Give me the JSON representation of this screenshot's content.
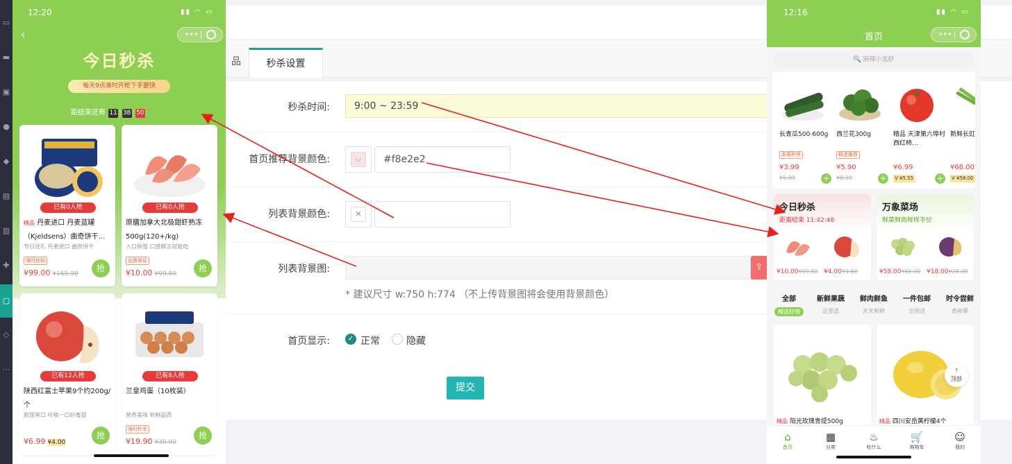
{
  "admin": {
    "tabs": {
      "prev_partial": "品",
      "seckill": "秒杀设置"
    },
    "form": {
      "time_label": "秒杀时间:",
      "time_value": "9:00 ~ 23:59",
      "home_bg_label": "首页推荐背景颜色:",
      "home_bg_value": "#f8e2e2",
      "home_bg_color": "#f8e2e2",
      "list_bg_label": "列表背景颜色:",
      "list_bg_value": "",
      "list_img_label": "列表背景图:",
      "size_hint": "* 建议尺寸 w:750 h:774 （不上传背景图将会使用背景颜色）",
      "home_show_label": "首页显示:",
      "opt_normal": "正常",
      "opt_hidden": "隐藏",
      "submit": "提交"
    }
  },
  "phone_left": {
    "time": "12:20",
    "title": "今日秒杀",
    "slogan": "每天9点准时开枪下手要快",
    "countdown_label": "距结束还有",
    "countdown": [
      "11",
      "38",
      "50"
    ],
    "products": [
      {
        "sold": "已有0人抢",
        "flag": "精品",
        "name": "丹麦进口 丹麦蓝罐（Kjeldsens）曲奇饼干…",
        "sub": "节日送礼 丹麦进口 曲奇饼干",
        "tag": "限时抢购",
        "price": "¥99.00",
        "old": "¥165.99",
        "grab": "抢"
      },
      {
        "sold": "已有0人抢",
        "flag": "",
        "name": "原膳加拿大北极甜虾熟冻 500g(120+/kg)",
        "sub": "入口鲜甜 口感解冻就能吃",
        "tag": "品质保证",
        "price": "¥10.00",
        "old": "¥99.80",
        "grab": "抢"
      },
      {
        "sold": "已有12人抢",
        "flag": "",
        "name": "陕西红富士苹果9个约200g/个",
        "sub": "脆甜爽口 咔嚓一口好香甜",
        "tag": "",
        "price": "¥6.99",
        "old": "¥4.00",
        "grab": "抢"
      },
      {
        "sold": "已有8人抢",
        "flag": "",
        "name": "兰皇鸡蛋（10枚装）",
        "sub": "营养美味 新鲜品质",
        "tag": "限时秒杀",
        "price": "¥19.90",
        "old": "¥39.90",
        "grab": "抢"
      }
    ]
  },
  "phone_right": {
    "time": "12:16",
    "title": "首页",
    "search_placeholder": "🔍 麻辣小龙虾",
    "strip": [
      {
        "name": "长青瓜500-600g",
        "tag": "本周秒杀",
        "price": "¥3.99",
        "old": "¥5.99"
      },
      {
        "name": "西兰花300g",
        "tag": "精选推荐",
        "price": "¥5.90",
        "old": "¥8.99"
      },
      {
        "name": "精品 天津第六埠村西红柿…",
        "tag": "",
        "price": "¥6.99",
        "vip": "V ¥5.55"
      },
      {
        "name": "新鲜长豇豆角",
        "tag": "",
        "price": "¥68.00",
        "vip": "V ¥58.00"
      }
    ],
    "promo_seckill": {
      "title": "今日秒杀",
      "sub": "距离结束 11:42:48",
      "p1": "¥10.00",
      "o1": "¥99.80",
      "p2": "¥4.00",
      "o2": "¥9.00"
    },
    "promo_market": {
      "title": "万象菜场",
      "sub": "鲜菜鲜肉样样平价",
      "p1": "¥58.00",
      "o1": "¥66.00",
      "p2": "¥18.00",
      "o2": "¥28.00"
    },
    "cats": [
      {
        "name": "全部",
        "sub": "精选好物"
      },
      {
        "name": "新鲜果蔬",
        "sub": "这里选"
      },
      {
        "name": "鲜肉鲜鱼",
        "sub": "天天新鲜"
      },
      {
        "name": "一件包邮",
        "sub": "全国送"
      },
      {
        "name": "时令尝鲜",
        "sub": "食鲜果"
      }
    ],
    "goods": [
      {
        "flag": "精品",
        "name": "阳光玫瑰青提500g"
      },
      {
        "flag": "精品",
        "name": "四川安岳黄柠檬4个"
      }
    ],
    "backtop": "顶部",
    "nav": [
      {
        "icon": "⌂",
        "label": "首页"
      },
      {
        "icon": "▦",
        "label": "分类"
      },
      {
        "icon": "♨",
        "label": "吃什么"
      },
      {
        "icon": "🛒",
        "label": "购物车"
      },
      {
        "icon": "☺",
        "label": "我的"
      }
    ]
  },
  "colors": {
    "accent": "#1aa392",
    "phone_green": "#8ccf52",
    "arrow": "#e8201c",
    "price_red": "#e53b3b"
  }
}
